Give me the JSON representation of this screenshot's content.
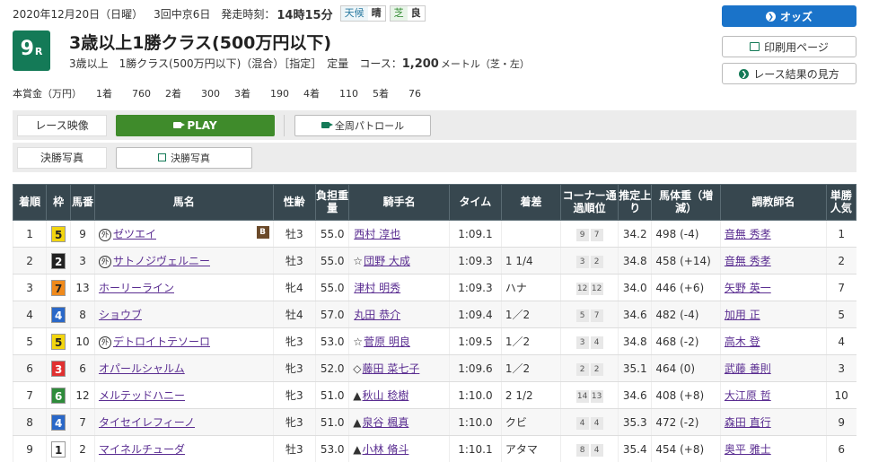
{
  "header": {
    "date": "2020年12月20日（日曜）",
    "meeting": "3回中京6日",
    "post_time_label": "発走時刻：",
    "post_time": "14時15分",
    "weather_label": "天候",
    "weather": "晴",
    "track_label": "芝",
    "track": "良"
  },
  "race": {
    "number": "9",
    "suffix": "R",
    "title": "3歳以上1勝クラス(500万円以下)",
    "sub_age_class": "3歳以上　1勝クラス(500万円以下)（混合）［指定］　定量",
    "course_label": "コース：",
    "distance": "1,200",
    "unit": "メートル（芝・左）"
  },
  "prize": {
    "label": "本賞金（万円）",
    "items": [
      "1着　　760",
      "2着　　300",
      "3着　　190",
      "4着　　110",
      "5着　　76"
    ]
  },
  "buttons": {
    "odds": "オッズ",
    "print": "印刷用ページ",
    "howto": "レース結果の見方"
  },
  "media": {
    "video_label": "レース映像",
    "play": "PLAY",
    "patrol": "全周パトロール",
    "photo_label": "決勝写真",
    "photo_button": "決勝写真"
  },
  "table": {
    "headers": [
      "着順",
      "枠",
      "馬番",
      "馬名",
      "性齢",
      "負担重量",
      "騎手名",
      "タイム",
      "着差",
      "コーナー通過順位",
      "推定上り",
      "馬体重（増減）",
      "調教師名",
      "単勝人気"
    ],
    "rows": [
      {
        "pos": "1",
        "waku": "5",
        "num": "9",
        "name": "ゼツエイ",
        "gai": true,
        "blink": "B",
        "sex": "牡3",
        "wt": "55.0",
        "jmark": "",
        "jockey": "西村 淳也",
        "time": "1:09.1",
        "margin": "",
        "c1": "9",
        "c2": "7",
        "up": "34.2",
        "bw": "498 (-4)",
        "trainer": "音無 秀孝",
        "pop": "1"
      },
      {
        "pos": "2",
        "waku": "2",
        "num": "3",
        "name": "サトノジヴェルニー",
        "gai": true,
        "blink": "",
        "sex": "牡3",
        "wt": "55.0",
        "jmark": "☆",
        "jockey": "団野 大成",
        "time": "1:09.3",
        "margin": "1 1/4",
        "c1": "3",
        "c2": "2",
        "up": "34.8",
        "bw": "458 (+14)",
        "trainer": "音無 秀孝",
        "pop": "2"
      },
      {
        "pos": "3",
        "waku": "7",
        "num": "13",
        "name": "ホーリーライン",
        "gai": false,
        "blink": "",
        "sex": "牝4",
        "wt": "55.0",
        "jmark": "",
        "jockey": "津村 明秀",
        "time": "1:09.3",
        "margin": "ハナ",
        "c1": "12",
        "c2": "12",
        "up": "34.0",
        "bw": "446 (+6)",
        "trainer": "矢野 英一",
        "pop": "7"
      },
      {
        "pos": "4",
        "waku": "4",
        "num": "8",
        "name": "ショウブ",
        "gai": false,
        "blink": "",
        "sex": "牡4",
        "wt": "57.0",
        "jmark": "",
        "jockey": "丸田 恭介",
        "time": "1:09.4",
        "margin": "1／2",
        "c1": "5",
        "c2": "7",
        "up": "34.6",
        "bw": "482 (-4)",
        "trainer": "加用 正",
        "pop": "5"
      },
      {
        "pos": "5",
        "waku": "5",
        "num": "10",
        "name": "デトロイトテソーロ",
        "gai": true,
        "blink": "",
        "sex": "牝3",
        "wt": "53.0",
        "jmark": "☆",
        "jockey": "菅原 明良",
        "time": "1:09.5",
        "margin": "1／2",
        "c1": "3",
        "c2": "4",
        "up": "34.8",
        "bw": "468 (-2)",
        "trainer": "高木 登",
        "pop": "4"
      },
      {
        "pos": "6",
        "waku": "3",
        "num": "6",
        "name": "オパールシャルム",
        "gai": false,
        "blink": "",
        "sex": "牝3",
        "wt": "52.0",
        "jmark": "◇",
        "jockey": "藤田 菜七子",
        "time": "1:09.6",
        "margin": "1／2",
        "c1": "2",
        "c2": "2",
        "up": "35.1",
        "bw": "464 (0)",
        "trainer": "武藤 善則",
        "pop": "3"
      },
      {
        "pos": "7",
        "waku": "6",
        "num": "12",
        "name": "メルテッドハニー",
        "gai": false,
        "blink": "",
        "sex": "牝3",
        "wt": "51.0",
        "jmark": "▲",
        "jockey": "秋山 稔樹",
        "time": "1:10.0",
        "margin": "2 1/2",
        "c1": "14",
        "c2": "13",
        "up": "34.6",
        "bw": "408 (+8)",
        "trainer": "大江原 哲",
        "pop": "10"
      },
      {
        "pos": "8",
        "waku": "4",
        "num": "7",
        "name": "タイセイレフィーノ",
        "gai": false,
        "blink": "",
        "sex": "牝3",
        "wt": "51.0",
        "jmark": "▲",
        "jockey": "泉谷 楓真",
        "time": "1:10.0",
        "margin": "クビ",
        "c1": "4",
        "c2": "4",
        "up": "35.3",
        "bw": "472 (-2)",
        "trainer": "森田 直行",
        "pop": "9"
      },
      {
        "pos": "9",
        "waku": "1",
        "num": "2",
        "name": "マイネルチューダ",
        "gai": false,
        "blink": "",
        "sex": "牡3",
        "wt": "53.0",
        "jmark": "▲",
        "jockey": "小林 脩斗",
        "time": "1:10.1",
        "margin": "アタマ",
        "c1": "8",
        "c2": "4",
        "up": "35.4",
        "bw": "454 (+8)",
        "trainer": "奥平 雅士",
        "pop": "6"
      }
    ]
  },
  "colors": {
    "waku": {
      "1": "#ffffff",
      "2": "#222222",
      "3": "#e03030",
      "4": "#2a68c8",
      "5": "#f2d50f",
      "6": "#2e8b3a",
      "7": "#f08a1c",
      "8": "#f07aa5"
    },
    "waku_text": {
      "1": "#222222",
      "2": "#ffffff",
      "3": "#ffffff",
      "4": "#ffffff",
      "5": "#222222",
      "6": "#ffffff",
      "7": "#222222",
      "8": "#222222"
    },
    "badge": "#147a57",
    "odds_button": "#1a73c9",
    "play_button": "#3f8b2b",
    "table_header": "#37474f"
  }
}
